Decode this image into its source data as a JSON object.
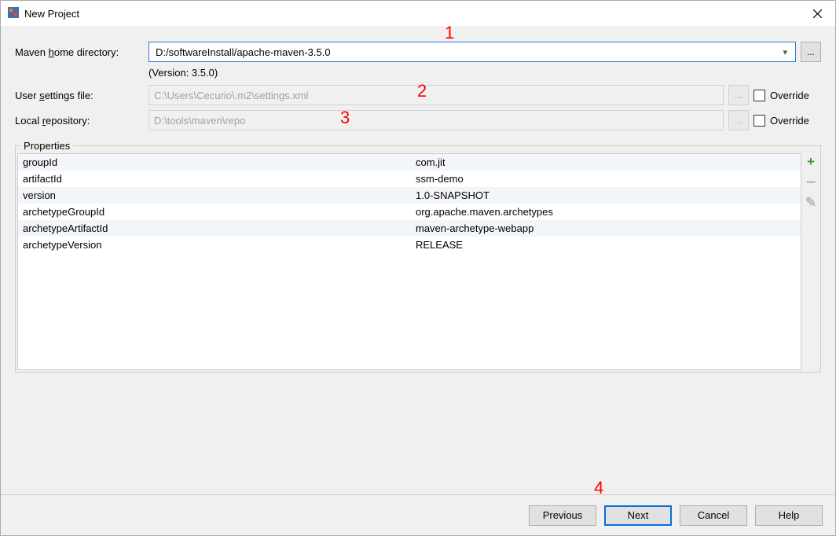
{
  "window": {
    "title": "New Project"
  },
  "labels": {
    "maven_home_pre": "Maven ",
    "maven_home_u": "h",
    "maven_home_post": "ome directory:",
    "user_settings_pre": "User ",
    "user_settings_u": "s",
    "user_settings_post": "ettings file:",
    "local_repo_pre": "Local ",
    "local_repo_u": "r",
    "local_repo_post": "epository:"
  },
  "fields": {
    "maven_home": "D:/softwareInstall/apache-maven-3.5.0",
    "version_text": "(Version: 3.5.0)",
    "user_settings": "C:\\Users\\Cecurio\\.m2\\settings.xml",
    "local_repo": "D:\\tools\\maven\\repo",
    "override_label": "Override"
  },
  "browse_label": "...",
  "properties": {
    "legend": "Properties",
    "rows": [
      {
        "key": "groupId",
        "val": "com.jit"
      },
      {
        "key": "artifactId",
        "val": "ssm-demo"
      },
      {
        "key": "version",
        "val": "1.0-SNAPSHOT"
      },
      {
        "key": "archetypeGroupId",
        "val": "org.apache.maven.archetypes"
      },
      {
        "key": "archetypeArtifactId",
        "val": "maven-archetype-webapp"
      },
      {
        "key": "archetypeVersion",
        "val": "RELEASE"
      }
    ]
  },
  "actions": {
    "add": "+",
    "remove": "−",
    "edit": "✎"
  },
  "buttons": {
    "previous": "Previous",
    "next": "Next",
    "cancel": "Cancel",
    "help": "Help"
  },
  "annotations": {
    "a1": "1",
    "a2": "2",
    "a3": "3",
    "a4": "4"
  }
}
